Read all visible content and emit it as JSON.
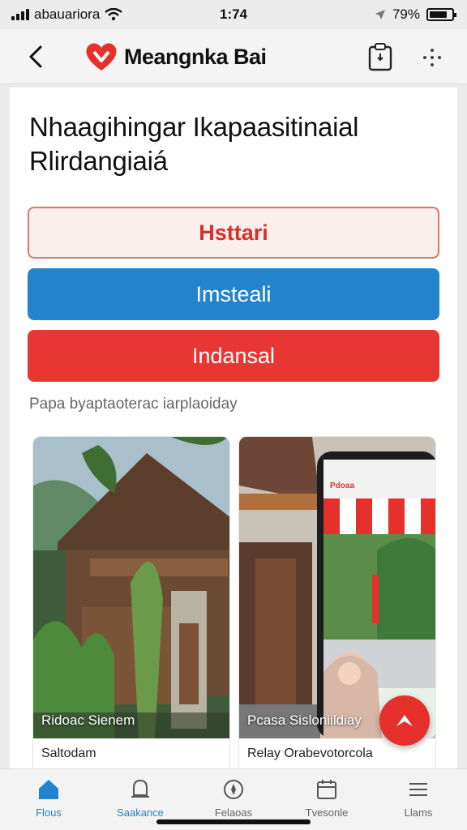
{
  "status": {
    "carrier": "abauariora",
    "time": "1:74",
    "battery": "79%",
    "battery_level": 0.79
  },
  "appbar": {
    "brand": "Meangnka Bai",
    "back_icon": "chevron-left-icon",
    "clip_icon": "clipboard-icon",
    "more_icon": "more-dots-icon"
  },
  "main": {
    "title_line1": "Nhaagihingar Ikapaasitinaial",
    "title_line2": "Rlirdangiaiá",
    "button1": "Hsttari",
    "button2": "Imsteali",
    "button3": "Indansal",
    "hint": "Papa byaptaoterac iarplaoiday"
  },
  "photos": [
    {
      "caption": "Ridoac Sienem",
      "label": "Saltodam"
    },
    {
      "caption": "Pcasa Sisloniildiay",
      "label": "Relay Orabevotorcola",
      "mini_brand": "Pdoaa"
    }
  ],
  "tabs": [
    {
      "label": "Flous",
      "icon": "home-icon"
    },
    {
      "label": "Saakance",
      "icon": "bell-icon"
    },
    {
      "label": "Felaoas",
      "icon": "compass-icon"
    },
    {
      "label": "Tvesonle",
      "icon": "calendar-icon"
    },
    {
      "label": "Llams",
      "icon": "menu-icon"
    }
  ],
  "colors": {
    "accent_blue": "#2383cd",
    "accent_red": "#e83732",
    "outline_red": "#e0736c"
  }
}
